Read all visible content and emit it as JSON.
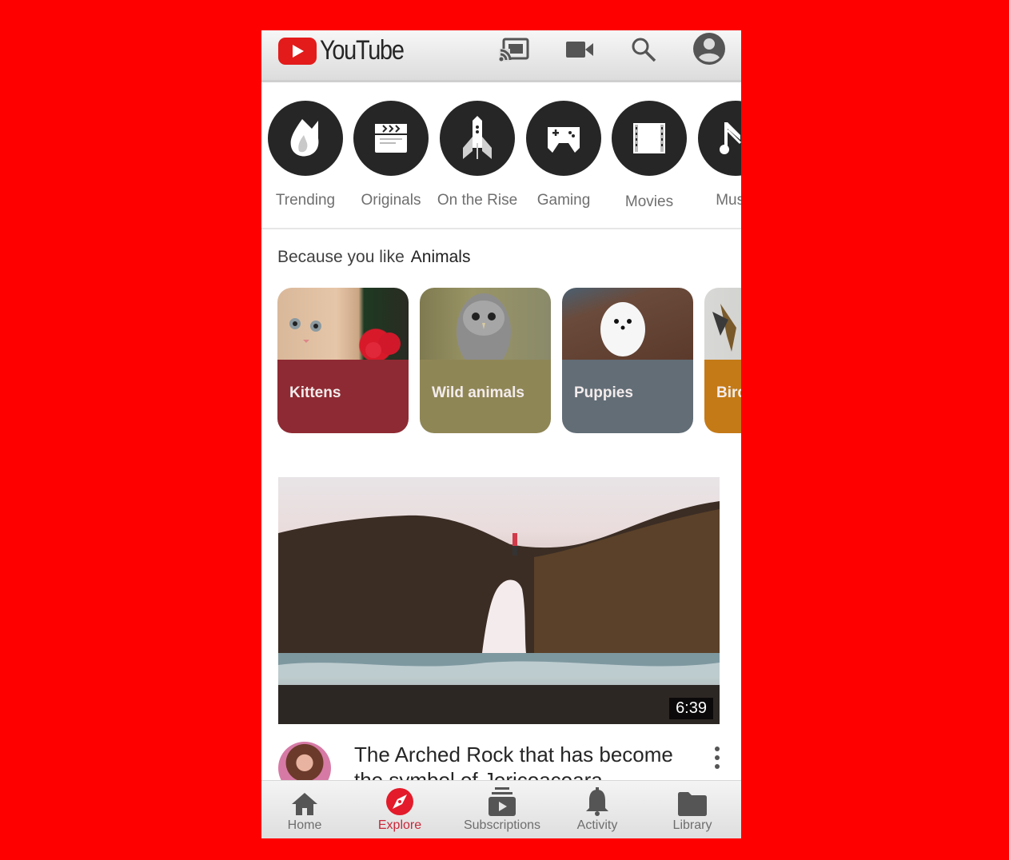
{
  "app": {
    "name": "YouTube"
  },
  "header": {
    "logo_text": "YouTube",
    "icons": [
      "cast-icon",
      "camera-icon",
      "search-icon",
      "account-icon"
    ]
  },
  "categories": [
    {
      "label": "Trending",
      "icon": "flame-icon"
    },
    {
      "label": "Originals",
      "icon": "clapperboard-icon"
    },
    {
      "label": "On the Rise",
      "icon": "rocket-icon"
    },
    {
      "label": "Gaming",
      "icon": "gamepad-icon"
    },
    {
      "label": "Movies",
      "icon": "film-icon"
    },
    {
      "label": "Music",
      "icon": "music-note-icon"
    }
  ],
  "because": {
    "prefix": "Because you like",
    "topic": "Animals",
    "cards": [
      {
        "label": "Kittens",
        "color": "#8e2a33"
      },
      {
        "label": "Wild animals",
        "color": "#8f8656"
      },
      {
        "label": "Puppies",
        "color": "#626d76"
      },
      {
        "label": "Birds",
        "color": "#c47a17"
      }
    ]
  },
  "video": {
    "duration": "6:39",
    "title": "The Arched Rock that has become the symbol of Jericoacoara"
  },
  "bottom_nav": [
    {
      "label": "Home",
      "icon": "home-icon",
      "active": false
    },
    {
      "label": "Explore",
      "icon": "compass-icon",
      "active": true
    },
    {
      "label": "Subscriptions",
      "icon": "subscriptions-icon",
      "active": false
    },
    {
      "label": "Activity",
      "icon": "bell-icon",
      "active": false
    },
    {
      "label": "Library",
      "icon": "folder-icon",
      "active": false
    }
  ],
  "colors": {
    "background": "#fe0000",
    "accent": "#e31b1b",
    "explore_active": "#c8283a"
  }
}
